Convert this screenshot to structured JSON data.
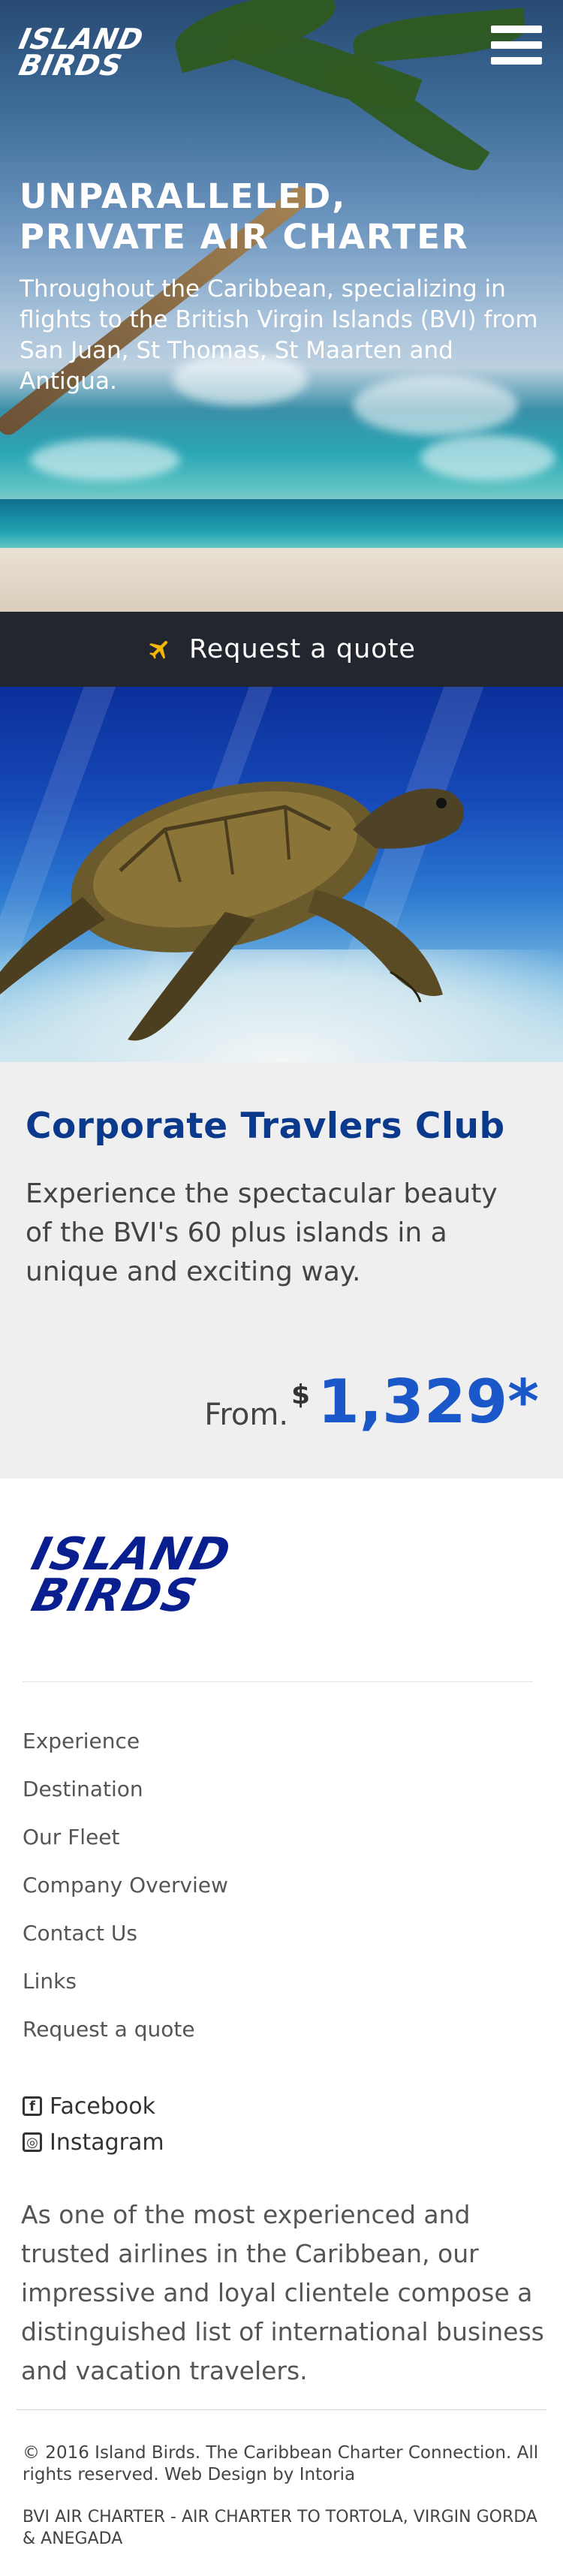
{
  "brand": {
    "logo_line1": "ISLAND",
    "logo_line2": "BIRDS"
  },
  "header": {
    "menu_icon": "hamburger-menu-icon"
  },
  "hero": {
    "title_line1": "UNPARALLELED,",
    "title_line2": "PRIVATE AIR CHARTER",
    "description": "Throughout the Caribbean, specializing in flights to the British Virgin Islands (BVI) from San Juan, St Thomas, St Maarten and Antigua."
  },
  "quote_bar": {
    "icon": "airplane-icon",
    "label": "Request a quote"
  },
  "promo": {
    "title": "Corporate Travlers Club",
    "description": "Experience the spectacular beauty of the BVI's 60 plus islands in a unique and exciting way.",
    "price_prefix": "From.",
    "currency": "$",
    "amount": "1,329*"
  },
  "footer": {
    "logo_line1": "ISLAND",
    "logo_line2": "BIRDS",
    "nav": [
      "Experience",
      "Destination",
      "Our Fleet",
      "Company Overview",
      "Contact Us",
      "Links",
      "Request a quote"
    ],
    "social": [
      {
        "icon": "facebook-icon",
        "label": "Facebook"
      },
      {
        "icon": "instagram-icon",
        "label": "Instagram"
      }
    ],
    "about": "As one of the most experienced and trusted airlines in the Caribbean, our impressive and loyal clientele compose a distinguished list of international business and vacation travelers.",
    "copyright": "© 2016 Island Birds. The Caribbean Charter Connection. All rights reserved. Web Design by Intoria",
    "tagline": "BVI AIR CHARTER - AIR CHARTER TO TORTOLA, VIRGIN GORDA & ANEGADA"
  },
  "colors": {
    "quote_bar_bg": "#23262f",
    "promo_title": "#0b3a8c",
    "price": "#1a57c9",
    "plane_icon": "#f2b705",
    "footer_logo": "#0a1f8f"
  }
}
